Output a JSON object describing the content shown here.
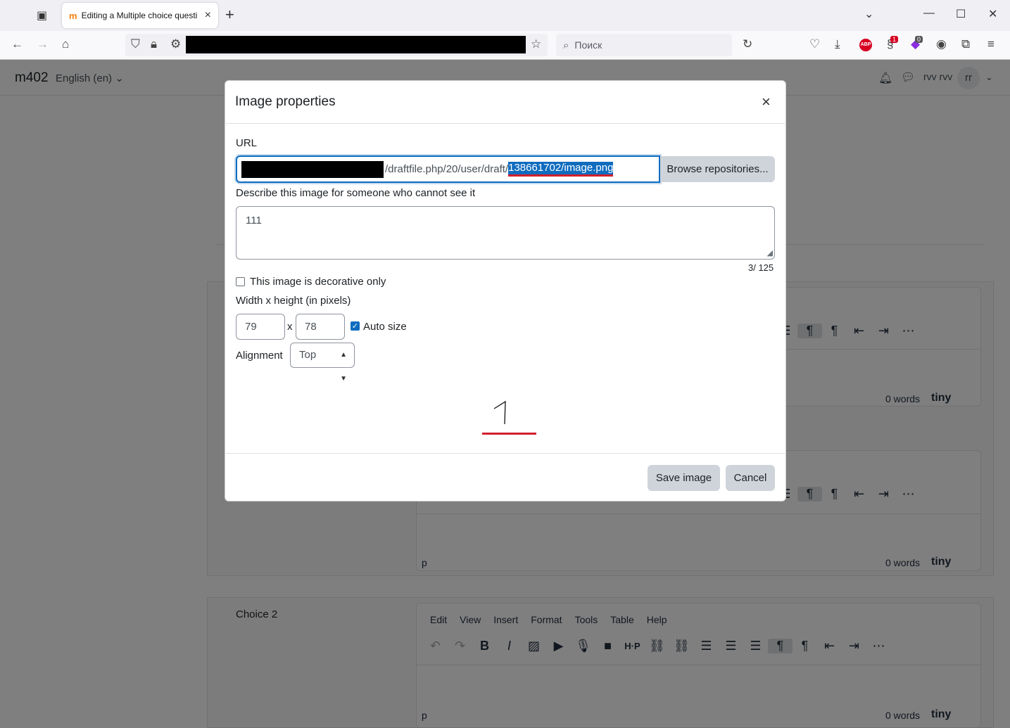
{
  "browser": {
    "tab_title": "Editing a Multiple choice questi",
    "tab_favicon": "m",
    "search_placeholder": "Поиск",
    "badge_1": "1",
    "badge_2": "0",
    "abp_label": "ABP"
  },
  "moodle": {
    "brand": "m402",
    "language": "English (en) ⌄",
    "user_name": "rvv rvv",
    "avatar_initials": "rr",
    "choice2_label": "Choice 2",
    "editor_menu": [
      "Edit",
      "View",
      "Insert",
      "Format",
      "Tools",
      "Table",
      "Help"
    ],
    "status_tag": "p",
    "word_count": "0 words",
    "tiny_label": "tiny"
  },
  "dialog": {
    "title": "Image properties",
    "close_label": "×",
    "url_label": "URL",
    "url_path": "/draftfile.php/20/user/draft/",
    "url_selected": "138661702/image.png",
    "browse_label": "Browse repositories...",
    "alt_label": "Describe this image for someone who cannot see it",
    "alt_value": "111",
    "alt_counter": "3/ 125",
    "decorative_label": "This image is decorative only",
    "decorative_checked": false,
    "size_label": "Width x height (in pixels)",
    "width": "79",
    "height": "78",
    "times_label": "x",
    "autosize_label": "Auto size",
    "autosize_checked": true,
    "alignment_label": "Alignment",
    "alignment_value": "Top",
    "save_label": "Save image",
    "cancel_label": "Cancel"
  },
  "colors": {
    "primary": "#0f6cbf",
    "highlight_red": "#d21f2e",
    "button_gray": "#ced4da"
  }
}
